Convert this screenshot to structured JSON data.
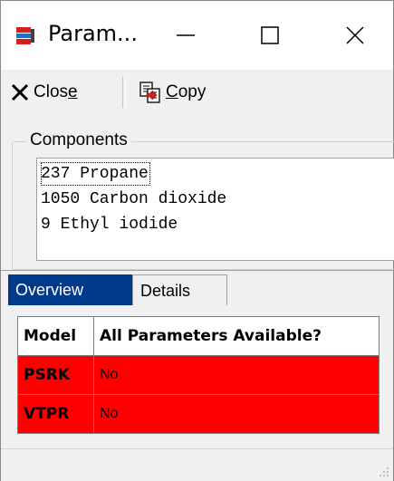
{
  "window": {
    "title": "Param..."
  },
  "titlebar_icons": {
    "app": "app-icon",
    "minimize": "minimize-icon",
    "maximize": "maximize-icon",
    "close": "close-icon"
  },
  "toolbar": {
    "close_label": "Close",
    "copy_label": "Copy",
    "close_icon": "x-icon",
    "copy_icon": "copy-icon"
  },
  "components": {
    "legend": "Components",
    "items": [
      "237 Propane",
      "1050 Carbon dioxide",
      "9 Ethyl iodide"
    ]
  },
  "tabs": [
    {
      "label": "Overview",
      "active": true
    },
    {
      "label": "Details",
      "active": false
    }
  ],
  "table": {
    "headers": [
      "Model",
      "All Parameters Available?"
    ],
    "rows": [
      [
        "PSRK",
        "No"
      ],
      [
        "VTPR",
        "No"
      ]
    ]
  },
  "colors": {
    "unavailable": "#ff0000",
    "active_tab": "#003a8c"
  }
}
